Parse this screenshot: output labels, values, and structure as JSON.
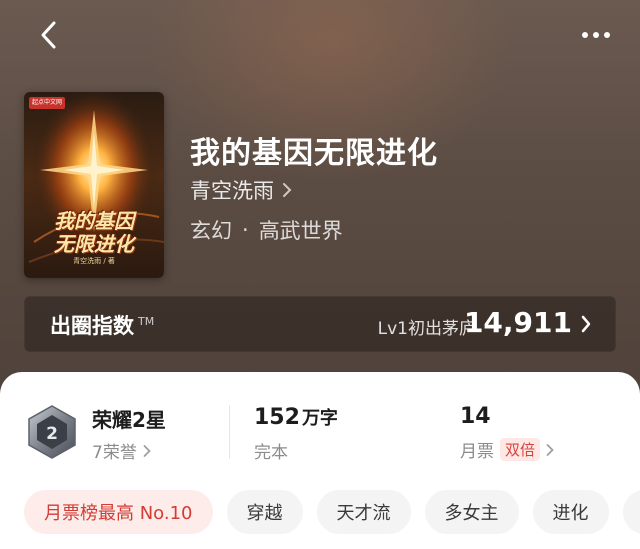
{
  "header": {
    "back_icon": "chevron-left-icon",
    "more_icon": "more-dots-icon"
  },
  "book": {
    "title": "我的基因无限进化",
    "author": "青空洗雨",
    "genre": "玄幻",
    "subgenre": "高武世界",
    "genre_separator": "·",
    "cover": {
      "publisher_badge": "起点中文网",
      "title_line1": "我的基因",
      "title_line2": "无限进化",
      "author_line": "青空洗雨 / 著"
    }
  },
  "index_bar": {
    "label": "出圈指数",
    "tm": "TM",
    "level": "Lv1初出茅庐",
    "value": "14,911"
  },
  "stats": {
    "honor": {
      "title": "荣耀2星",
      "sub": "7荣誉",
      "medal_number": "2"
    },
    "words": {
      "value": "152",
      "unit": "万字",
      "status": "完本"
    },
    "monthly_ticket": {
      "value": "14",
      "label": "月票",
      "badge": "双倍"
    }
  },
  "tags": [
    "月票榜最高 No.10",
    "穿越",
    "天才流",
    "多女主",
    "进化"
  ],
  "colors": {
    "accent_red": "#d8423a",
    "hero_bg": "#5b4c43"
  }
}
